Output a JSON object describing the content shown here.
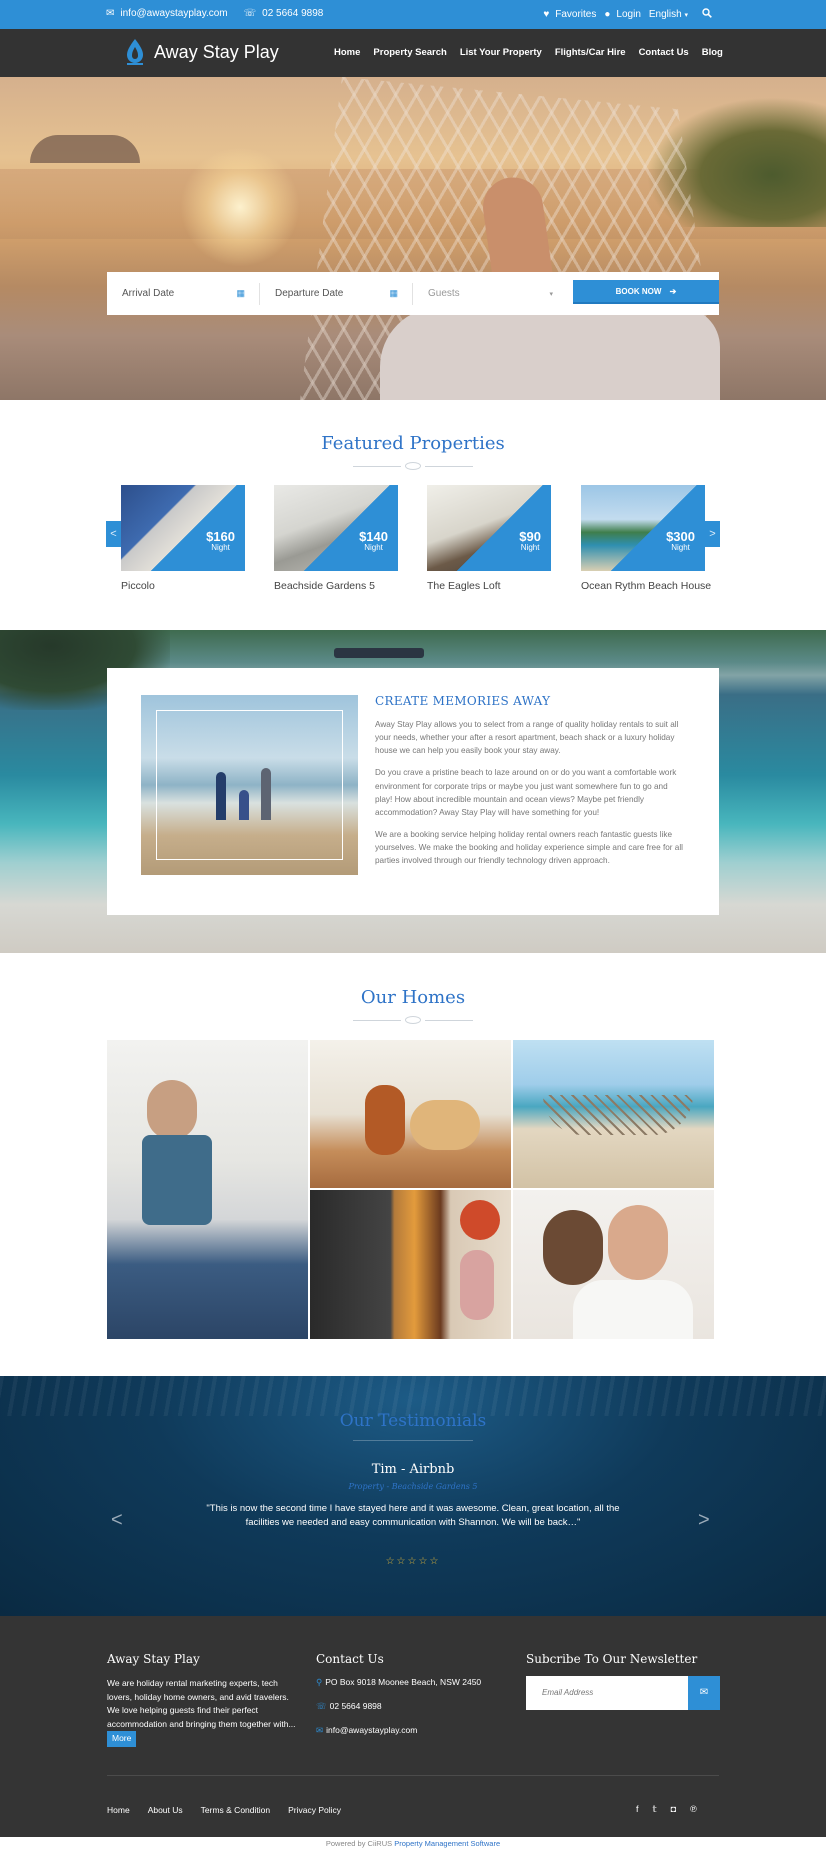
{
  "topbar": {
    "email": "info@awaystayplay.com",
    "phone": "02 5664 9898",
    "favorites": "Favorites",
    "login": "Login",
    "language": "English"
  },
  "nav": {
    "brand": "Away Stay Play",
    "items": [
      "Home",
      "Property Search",
      "List Your Property",
      "Flights/Car Hire",
      "Contact Us",
      "Blog"
    ]
  },
  "booking": {
    "arrival_placeholder": "Arrival Date",
    "departure_placeholder": "Departure Date",
    "guests_placeholder": "Guests",
    "book_label": "BOOK NOW"
  },
  "featured": {
    "title": "Featured Properties",
    "prev": "<",
    "next": ">",
    "items": [
      {
        "name": "Piccolo",
        "price": "$160",
        "unit": "Night"
      },
      {
        "name": "Beachside Gardens 5",
        "price": "$140",
        "unit": "Night"
      },
      {
        "name": "The Eagles Loft",
        "price": "$90",
        "unit": "Night"
      },
      {
        "name": "Ocean Rythm Beach House",
        "price": "$300",
        "unit": "Night"
      }
    ]
  },
  "memories": {
    "title": "CREATE MEMORIES AWAY",
    "paragraphs": [
      "Away Stay Play allows you to select from a range of quality holiday rentals to suit all your needs, whether your after a resort apartment, beach shack or a luxury holiday house we can help you easily book your stay away.",
      "Do you crave a pristine beach to laze around on or do you want a comfortable work environment for corporate trips or maybe you just want somewhere fun to go and play! How about incredible mountain and ocean views? Maybe pet friendly accommodation? Away Stay Play will have something for you!",
      "We are a booking service helping holiday rental owners reach fantastic guests like yourselves. We make the booking and holiday experience simple and care free for all parties involved through our friendly technology driven approach."
    ]
  },
  "homes": {
    "title": "Our Homes"
  },
  "testimonials": {
    "title": "Our Testimonials",
    "author": "Tim - Airbnb",
    "property": "Property - Beachside Gardens 5",
    "quote": "\"This is now the second time I have stayed here and it was awesome. Clean, great location, all the facilities we needed and easy communication with Shannon. We will be back…\"",
    "stars": "☆☆☆☆☆",
    "prev": "<",
    "next": ">"
  },
  "footer": {
    "about_title": "Away Stay Play",
    "about_text": "We are holiday rental marketing experts, tech lovers, holiday home owners, and avid travelers. We love helping guests find their perfect accommodation and bringing them together with...",
    "more": "More",
    "contact_title": "Contact Us",
    "address": "PO Box 9018 Moonee Beach, NSW 2450",
    "phone": "02 5664 9898",
    "email": "info@awaystayplay.com",
    "newsletter_title": "Subcribe To Our Newsletter",
    "newsletter_placeholder": "Email Address",
    "links": [
      "Home",
      "About Us",
      "Terms & Condition",
      "Privacy Policy"
    ],
    "social": [
      "facebook-icon",
      "twitter-icon",
      "instagram-icon",
      "pinterest-icon"
    ]
  },
  "powered": {
    "prefix": "Powered by CiiRUS",
    "link": "Property Management Software"
  },
  "colors": {
    "brand": "#2e8fd6",
    "title": "#2e73c7",
    "dark": "#333333",
    "star": "#d9b23a"
  }
}
